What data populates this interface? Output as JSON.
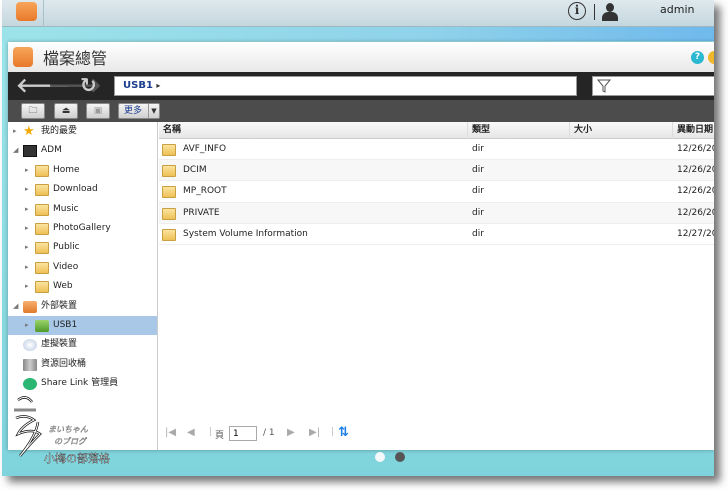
{
  "topbar": {
    "user": "admin",
    "info_icon": "info-icon",
    "user_icon": "user-icon"
  },
  "window": {
    "title": "檔案總管"
  },
  "nav": {
    "path": "USB1",
    "path_arrow": "▸"
  },
  "toolbar": {
    "more_label": "更多"
  },
  "sidebar": {
    "items": [
      {
        "label": "我的最愛",
        "icon": "star-icon",
        "level": 0
      },
      {
        "label": "ADM",
        "icon": "nas-icon",
        "level": 0
      },
      {
        "label": "Home",
        "icon": "folder-icon",
        "level": 1
      },
      {
        "label": "Download",
        "icon": "folder-icon",
        "level": 1
      },
      {
        "label": "Music",
        "icon": "folder-icon",
        "level": 1
      },
      {
        "label": "PhotoGallery",
        "icon": "folder-icon",
        "level": 1
      },
      {
        "label": "Public",
        "icon": "folder-icon",
        "level": 1
      },
      {
        "label": "Video",
        "icon": "folder-icon",
        "level": 1
      },
      {
        "label": "Web",
        "icon": "folder-icon",
        "level": 1
      },
      {
        "label": "外部裝置",
        "icon": "external-device-icon",
        "level": 0
      },
      {
        "label": "USB1",
        "icon": "usb-icon",
        "level": 1,
        "selected": true
      },
      {
        "label": "虛擬裝置",
        "icon": "virtual-device-icon",
        "level": 0
      },
      {
        "label": "資源回收桶",
        "icon": "trash-icon",
        "level": 0
      },
      {
        "label": "Share Link 管理員",
        "icon": "share-icon",
        "level": 0
      }
    ]
  },
  "table": {
    "columns": [
      "名稱",
      "類型",
      "大小",
      "異動日期"
    ],
    "rows": [
      {
        "name": "AVF_INFO",
        "type": "dir",
        "size": "",
        "date": "12/26/20"
      },
      {
        "name": "DCIM",
        "type": "dir",
        "size": "",
        "date": "12/26/20"
      },
      {
        "name": "MP_ROOT",
        "type": "dir",
        "size": "",
        "date": "12/26/20"
      },
      {
        "name": "PRIVATE",
        "type": "dir",
        "size": "",
        "date": "12/26/20"
      },
      {
        "name": "System Volume Information",
        "type": "dir",
        "size": "",
        "date": "12/27/20"
      }
    ]
  },
  "pager": {
    "page_label": "頁",
    "page": "1",
    "total": "/ 1"
  },
  "watermark": {
    "text": "まいちゃんのブログ 小梅の部落格"
  }
}
